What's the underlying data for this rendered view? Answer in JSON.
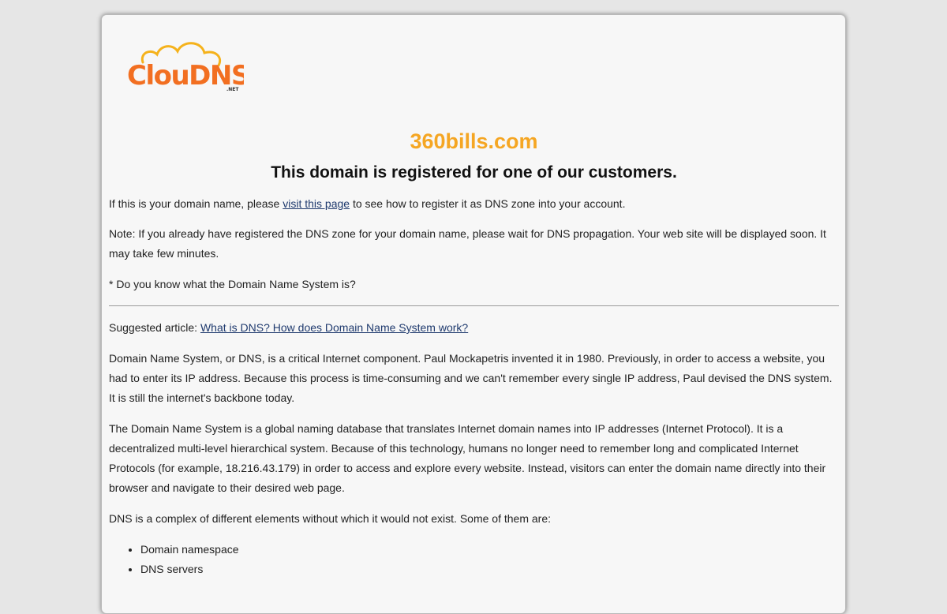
{
  "logo": {
    "text": "ClouDNS",
    "suffix": ".NET",
    "colors": {
      "primary": "#f26f21",
      "cloud": "#f5b21b"
    }
  },
  "domain": "360bills.com",
  "headline": "This domain is registered for one of our customers.",
  "intro": {
    "before": "If this is your domain name, please ",
    "link": "visit this page",
    "after": " to see how to register it as DNS zone into your account."
  },
  "note": "Note: If you already have registered the DNS zone for your domain name, please wait for DNS propagation. Your web site will be displayed soon. It may take few minutes.",
  "question": "* Do you know what the Domain Name System is?",
  "suggested": {
    "label": "Suggested article: ",
    "link": "What is DNS? How does Domain Name System work?"
  },
  "paragraphs": [
    "Domain Name System, or DNS, is a critical Internet component. Paul Mockapetris invented it in 1980. Previously, in order to access a website, you had to enter its IP address. Because this process is time-consuming and we can't remember every single IP address, Paul devised the DNS system. It is still the internet's backbone today.",
    "The Domain Name System is a global naming database that translates Internet domain names into IP addresses (Internet Protocol). It is a decentralized multi-level hierarchical system. Because of this technology, humans no longer need to remember long and complicated Internet Protocols (for example, 18.216.43.179) in order to access and explore every website. Instead, visitors can enter the domain name directly into their browser and navigate to their desired web page.",
    "DNS is a complex of different elements without which it would not exist. Some of them are:"
  ],
  "elements": [
    "Domain namespace",
    "DNS servers"
  ],
  "colors": {
    "domain_title": "#f5a623",
    "link": "#1f3a6e",
    "background": "#e6e6e6",
    "card": "#f7f7f7"
  }
}
